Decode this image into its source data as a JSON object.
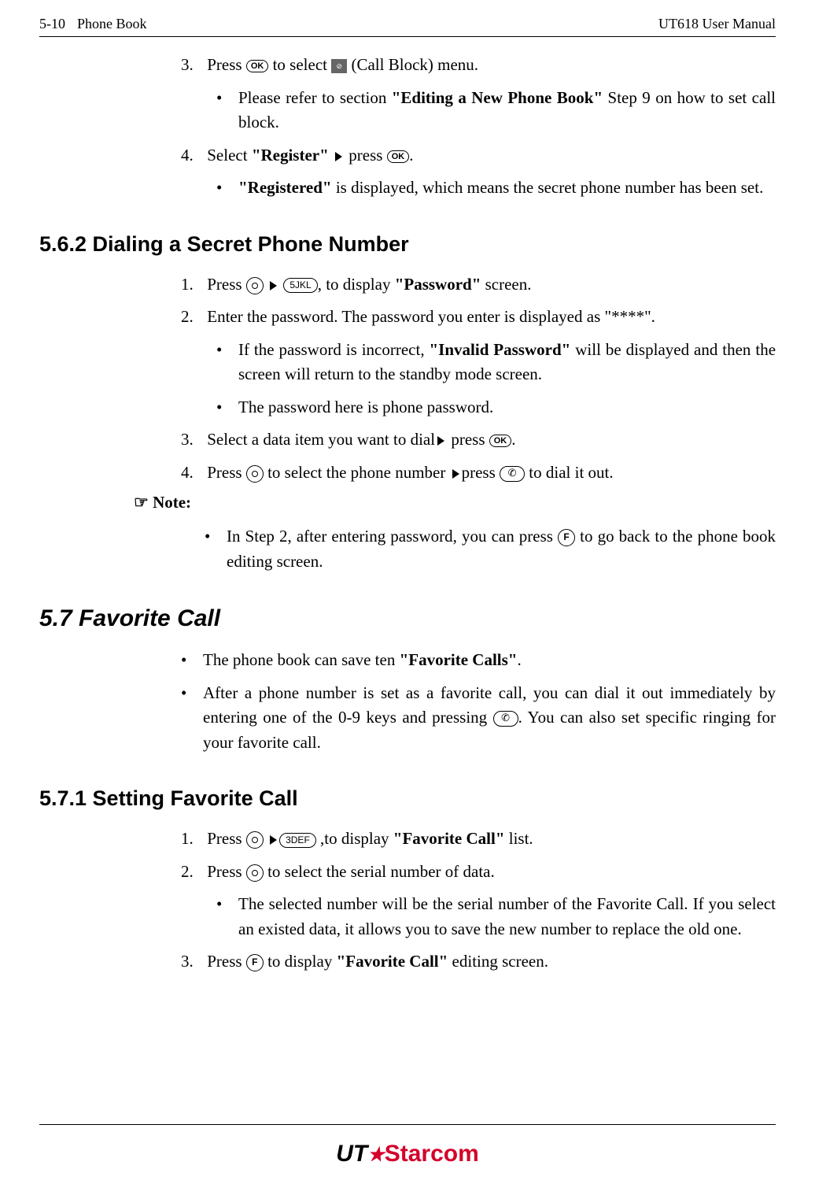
{
  "header": {
    "page_num": "5-10",
    "section": "Phone Book",
    "doc_title": "UT618 User Manual"
  },
  "body": {
    "step3_a": "Press ",
    "step3_b": " to select ",
    "step3_c": " (Call Block) menu.",
    "step3_bullet": "Please refer to section ",
    "step3_bullet_bold": "\"Editing a New Phone Book\"",
    "step3_bullet_end": " Step 9 on how to set call block.",
    "step4_a": "Select ",
    "step4_bold": "\"Register\"",
    "step4_b": " press ",
    "step4_bullet_bold": "\"Registered\"",
    "step4_bullet": " is displayed, which means the secret phone number has been set.",
    "h2_562": "5.6.2 Dialing a Secret Phone Number",
    "s562_1a": "Press ",
    "s562_1b": ", to display ",
    "s562_1bold": "\"Password\"",
    "s562_1c": " screen.",
    "s562_2": "Enter the password. The password you enter is displayed as \"****\".",
    "s562_2b1a": "If the password is incorrect, ",
    "s562_2b1bold": "\"Invalid Password\"",
    "s562_2b1b": " will be displayed and then the screen will return to the standby mode screen.",
    "s562_2b2": "The password here is phone password.",
    "s562_3a": "Select a data item you want to dial",
    "s562_3b": " press ",
    "s562_4a": "Press ",
    "s562_4b": " to select the phone number ",
    "s562_4c": "press ",
    "s562_4d": " to dial it out.",
    "note_label": " Note:",
    "note_b1a": "In Step 2, after entering password, you can press ",
    "note_b1b": " to go back to the phone book editing screen.",
    "h1_57": "5.7   Favorite Call",
    "s57_b1a": "The phone book can save ten ",
    "s57_b1bold": "\"Favorite Calls\"",
    "s57_b2a": "After a phone number is set as a favorite call, you can dial it out immediately by entering one of the 0-9 keys and pressing ",
    "s57_b2b": ". You can also set specific ringing for your favorite call.",
    "h2_571": "5.7.1 Setting Favorite Call",
    "s571_1a": "Press ",
    "s571_1b": " ,to display ",
    "s571_1bold": "\"Favorite Call\"",
    "s571_1c": " list.",
    "s571_2a": "Press ",
    "s571_2b": " to select the serial number of data.",
    "s571_2bullet": "The selected number will be the serial number of the Favorite Call. If you select an existed data, it allows you to save the new number to replace the old one.",
    "s571_3a": "Press ",
    "s571_3b": " to display ",
    "s571_3bold": "\"Favorite Call\"",
    "s571_3c": " editing screen.",
    "icons": {
      "ok": "OK",
      "key5": "5JKL",
      "key3": "3DEF",
      "key_f": "F",
      "call": "✆"
    }
  },
  "footer": {
    "logo_ut": "UT",
    "logo_starcom": "Starcom"
  }
}
